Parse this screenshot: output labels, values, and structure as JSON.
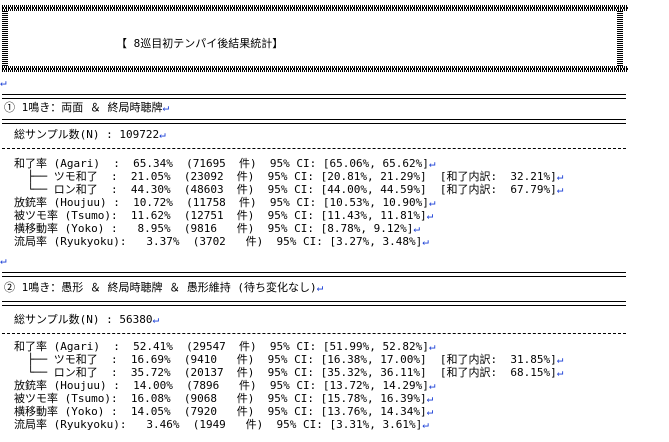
{
  "header": {
    "title": "【 8巡目初テンパイ後結果統計】"
  },
  "return_mark": "↵",
  "sections": [
    {
      "heading": "① 1鳴き：両面 ＆ 終局時聴牌",
      "total_label": "総サンプル数(N) : 109722",
      "rows": [
        "和了率 (Agari)  :  65.34%  (71695  件)  95% CI: [65.06%, 65.62%]",
        "  ├── ツモ和了  :  21.05%  (23092  件)  95% CI: [20.81%, 21.29%]  [和了内訳:  32.21%]",
        "  └── ロン和了  :  44.30%  (48603  件)  95% CI: [44.00%, 44.59%]  [和了内訳:  67.79%]",
        "放銃率 (Houjuu) :  10.72%  (11758  件)  95% CI: [10.53%, 10.90%]",
        "被ツモ率 (Tsumo):  11.62%  (12751  件)  95% CI: [11.43%, 11.81%]",
        "横移動率 (Yoko) :   8.95%  (9816   件)  95% CI: [8.78%, 9.12%]",
        "流局率 (Ryukyoku):   3.37%  (3702   件)  95% CI: [3.27%, 3.48%]"
      ]
    },
    {
      "heading": "② 1鳴き：愚形 ＆ 終局時聴牌 ＆ 愚形維持 (待ち変化なし)",
      "total_label": "総サンプル数(N) : 56380",
      "rows": [
        "和了率 (Agari)  :  52.41%  (29547  件)  95% CI: [51.99%, 52.82%]",
        "  ├── ツモ和了  :  16.69%  (9410   件)  95% CI: [16.38%, 17.00%]  [和了内訳:  31.85%]",
        "  └── ロン和了  :  35.72%  (20137  件)  95% CI: [35.32%, 36.11%]  [和了内訳:  68.15%]",
        "放銃率 (Houjuu) :  14.00%  (7896   件)  95% CI: [13.72%, 14.29%]",
        "被ツモ率 (Tsumo):  16.08%  (9068   件)  95% CI: [15.78%, 16.39%]",
        "横移動率 (Yoko) :  14.05%  (7920   件)  95% CI: [13.76%, 14.34%]",
        "流局率 (Ryukyoku):   3.46%  (1949   件)  95% CI: [3.31%, 3.61%]"
      ]
    }
  ]
}
